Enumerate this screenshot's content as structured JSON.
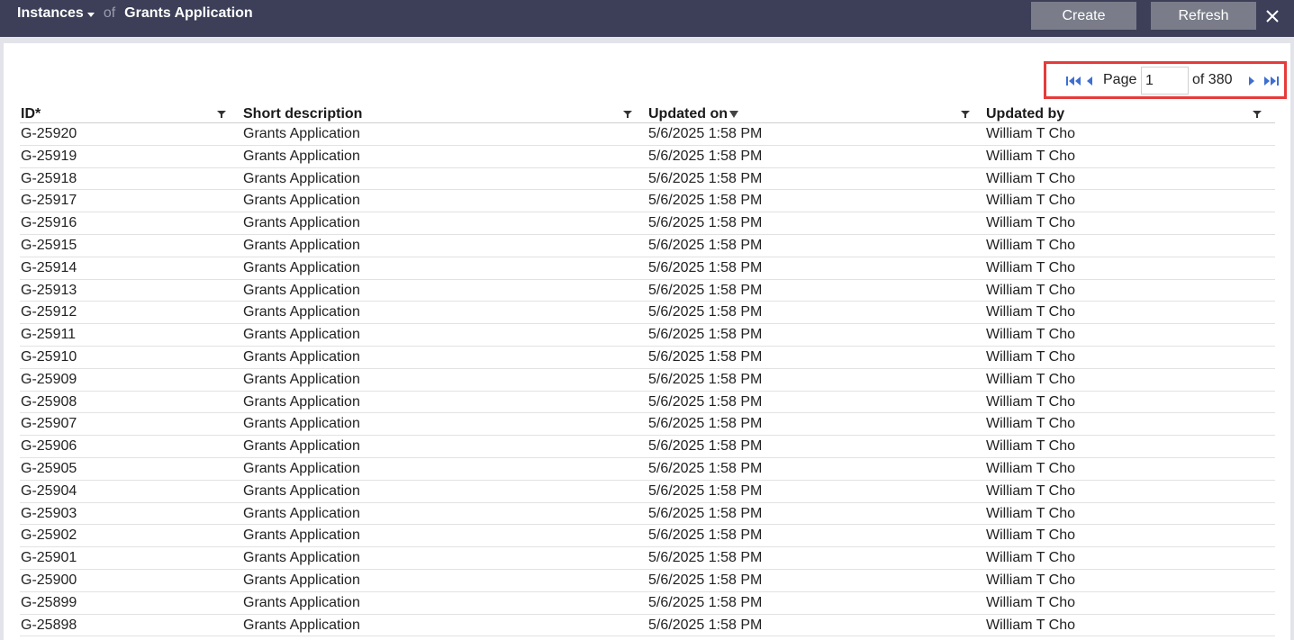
{
  "header": {
    "instances_label": "Instances",
    "of_label": "of",
    "app_title": "Grants Application",
    "create_label": "Create",
    "refresh_label": "Refresh"
  },
  "pager": {
    "page_label": "Page",
    "page_value": "1",
    "of_total": "of 380"
  },
  "table": {
    "columns": [
      "ID*",
      "Short description",
      "Updated on",
      "Updated by"
    ],
    "rows": [
      [
        "G-25920",
        "Grants Application",
        "5/6/2025 1:58 PM",
        "William T Cho"
      ],
      [
        "G-25919",
        "Grants Application",
        "5/6/2025 1:58 PM",
        "William T Cho"
      ],
      [
        "G-25918",
        "Grants Application",
        "5/6/2025 1:58 PM",
        "William T Cho"
      ],
      [
        "G-25917",
        "Grants Application",
        "5/6/2025 1:58 PM",
        "William T Cho"
      ],
      [
        "G-25916",
        "Grants Application",
        "5/6/2025 1:58 PM",
        "William T Cho"
      ],
      [
        "G-25915",
        "Grants Application",
        "5/6/2025 1:58 PM",
        "William T Cho"
      ],
      [
        "G-25914",
        "Grants Application",
        "5/6/2025 1:58 PM",
        "William T Cho"
      ],
      [
        "G-25913",
        "Grants Application",
        "5/6/2025 1:58 PM",
        "William T Cho"
      ],
      [
        "G-25912",
        "Grants Application",
        "5/6/2025 1:58 PM",
        "William T Cho"
      ],
      [
        "G-25911",
        "Grants Application",
        "5/6/2025 1:58 PM",
        "William T Cho"
      ],
      [
        "G-25910",
        "Grants Application",
        "5/6/2025 1:58 PM",
        "William T Cho"
      ],
      [
        "G-25909",
        "Grants Application",
        "5/6/2025 1:58 PM",
        "William T Cho"
      ],
      [
        "G-25908",
        "Grants Application",
        "5/6/2025 1:58 PM",
        "William T Cho"
      ],
      [
        "G-25907",
        "Grants Application",
        "5/6/2025 1:58 PM",
        "William T Cho"
      ],
      [
        "G-25906",
        "Grants Application",
        "5/6/2025 1:58 PM",
        "William T Cho"
      ],
      [
        "G-25905",
        "Grants Application",
        "5/6/2025 1:58 PM",
        "William T Cho"
      ],
      [
        "G-25904",
        "Grants Application",
        "5/6/2025 1:58 PM",
        "William T Cho"
      ],
      [
        "G-25903",
        "Grants Application",
        "5/6/2025 1:58 PM",
        "William T Cho"
      ],
      [
        "G-25902",
        "Grants Application",
        "5/6/2025 1:58 PM",
        "William T Cho"
      ],
      [
        "G-25901",
        "Grants Application",
        "5/6/2025 1:58 PM",
        "William T Cho"
      ],
      [
        "G-25900",
        "Grants Application",
        "5/6/2025 1:58 PM",
        "William T Cho"
      ],
      [
        "G-25899",
        "Grants Application",
        "5/6/2025 1:58 PM",
        "William T Cho"
      ],
      [
        "G-25898",
        "Grants Application",
        "5/6/2025 1:58 PM",
        "William T Cho"
      ]
    ]
  },
  "colors": {
    "topbar": "#3c3f57",
    "button": "#7a7d89",
    "pager_highlight": "#e63b3b",
    "nav_arrow": "#3d6fd0"
  },
  "icons": {
    "caret": "chevron-down-icon",
    "close": "close-icon",
    "filter": "filter-icon",
    "sort": "sort-descending-icon",
    "first": "first-page-icon",
    "prev": "previous-page-icon",
    "next": "next-page-icon",
    "last": "last-page-icon"
  }
}
